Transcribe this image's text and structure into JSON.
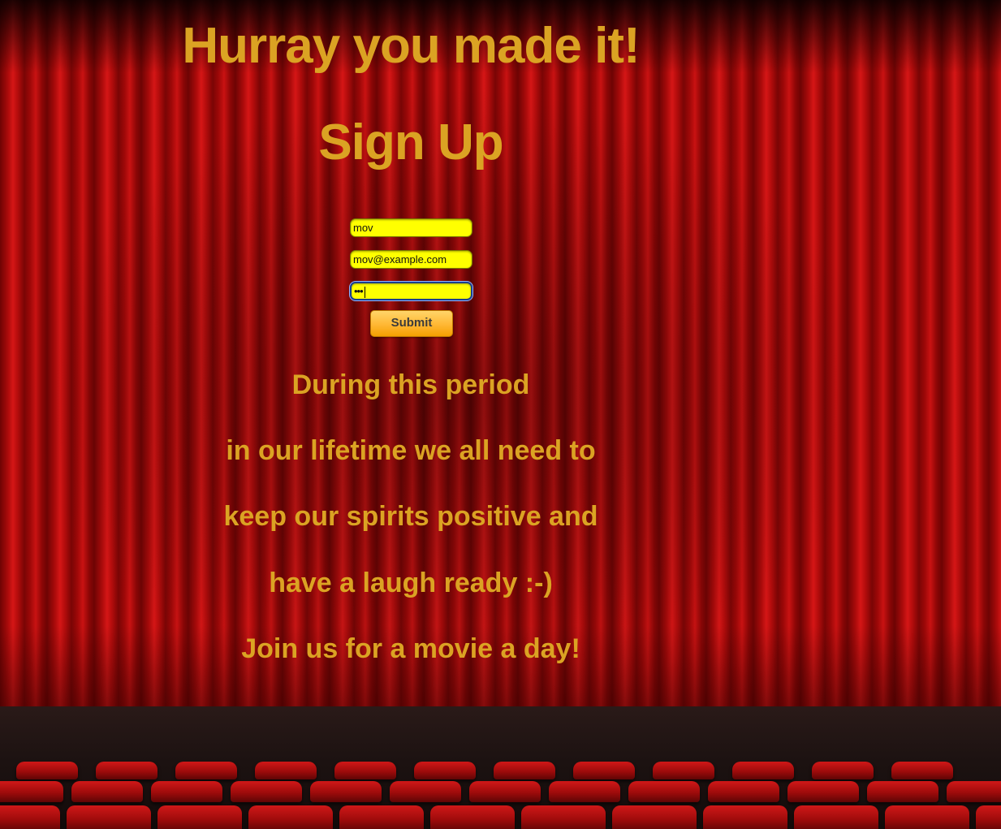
{
  "header": {
    "headline": "Hurray you made it!",
    "signup_title": "Sign Up"
  },
  "form": {
    "username_value": "mov",
    "email_value": "mov@example.com",
    "password_masked": "•••",
    "submit_label": "Submit"
  },
  "message": {
    "lines": [
      "During this period",
      "in our lifetime we all need to",
      "keep our spirits positive and",
      "have a laugh ready :-)",
      "Join us for a movie a day!"
    ]
  },
  "colors": {
    "heading_text": "#dba323",
    "field_background": "#ffff00",
    "button_background": "#ffb733",
    "curtain": "#a60a0a"
  },
  "icons": {
    "backdrop": "theater-curtain-image"
  }
}
